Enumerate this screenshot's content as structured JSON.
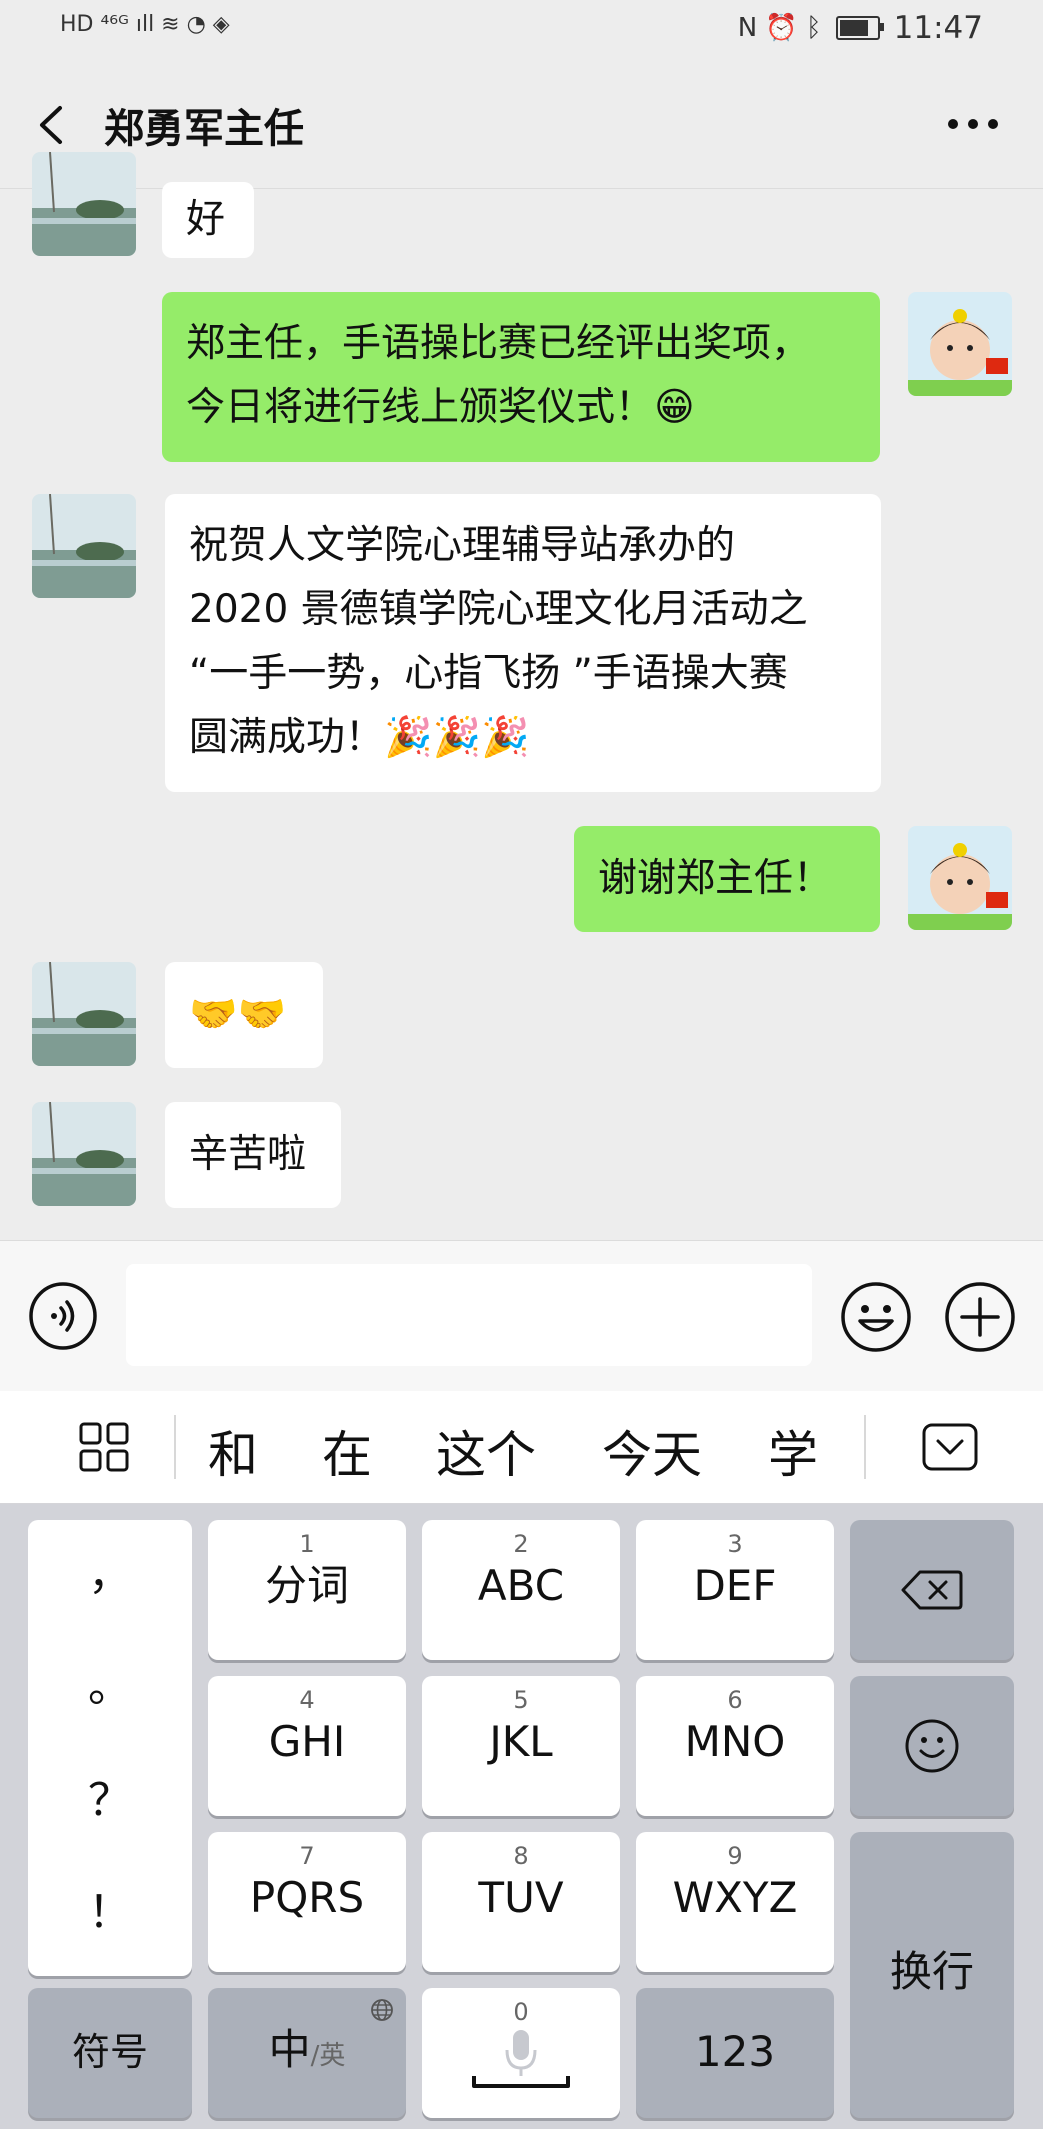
{
  "status_bar": {
    "left_text": "HD ⁴⁶ᴳ ıll ≋ ◔ ◈",
    "right_icons": "N ⏰ ᛒ",
    "time": "11:47"
  },
  "header": {
    "title": "郑勇军主任"
  },
  "messages": [
    {
      "side": "in",
      "lines": [
        "好"
      ]
    },
    {
      "side": "out",
      "lines": [
        "郑主任，手语操比赛已经评出奖项，",
        "今日将进行线上颁奖仪式！😁"
      ]
    },
    {
      "side": "in",
      "lines": [
        "祝贺人文学院心理辅导站承办的",
        "2020 景德镇学院心理文化月活动之",
        "“一手一势，心指飞扬 ”手语操大赛",
        "圆满成功！🎉🎉🎉"
      ]
    },
    {
      "side": "out",
      "lines": [
        "谢谢郑主任！"
      ]
    },
    {
      "side": "in",
      "lines": [
        "🤝🤝"
      ]
    },
    {
      "side": "in",
      "lines": [
        "辛苦啦"
      ]
    }
  ],
  "input": {
    "value": "",
    "placeholder": ""
  },
  "candidates": [
    "和",
    "在",
    "这个",
    "今天",
    "学"
  ],
  "keyboard": {
    "punctuation": [
      "，",
      "。",
      "？",
      "！"
    ],
    "keys": [
      {
        "num": "1",
        "label": "分词"
      },
      {
        "num": "2",
        "label": "ABC"
      },
      {
        "num": "3",
        "label": "DEF"
      },
      {
        "num": "4",
        "label": "GHI"
      },
      {
        "num": "5",
        "label": "JKL"
      },
      {
        "num": "6",
        "label": "MNO"
      },
      {
        "num": "7",
        "label": "PQRS"
      },
      {
        "num": "8",
        "label": "TUV"
      },
      {
        "num": "9",
        "label": "WXYZ"
      }
    ],
    "symbol_label": "符号",
    "lang_main": "中",
    "lang_alt": "/英",
    "space_num": "0",
    "numbers_label": "123",
    "enter_label": "换行"
  },
  "colors": {
    "outgoing_bubble": "#95ec69",
    "incoming_bubble": "#ffffff",
    "background": "#ededed"
  }
}
